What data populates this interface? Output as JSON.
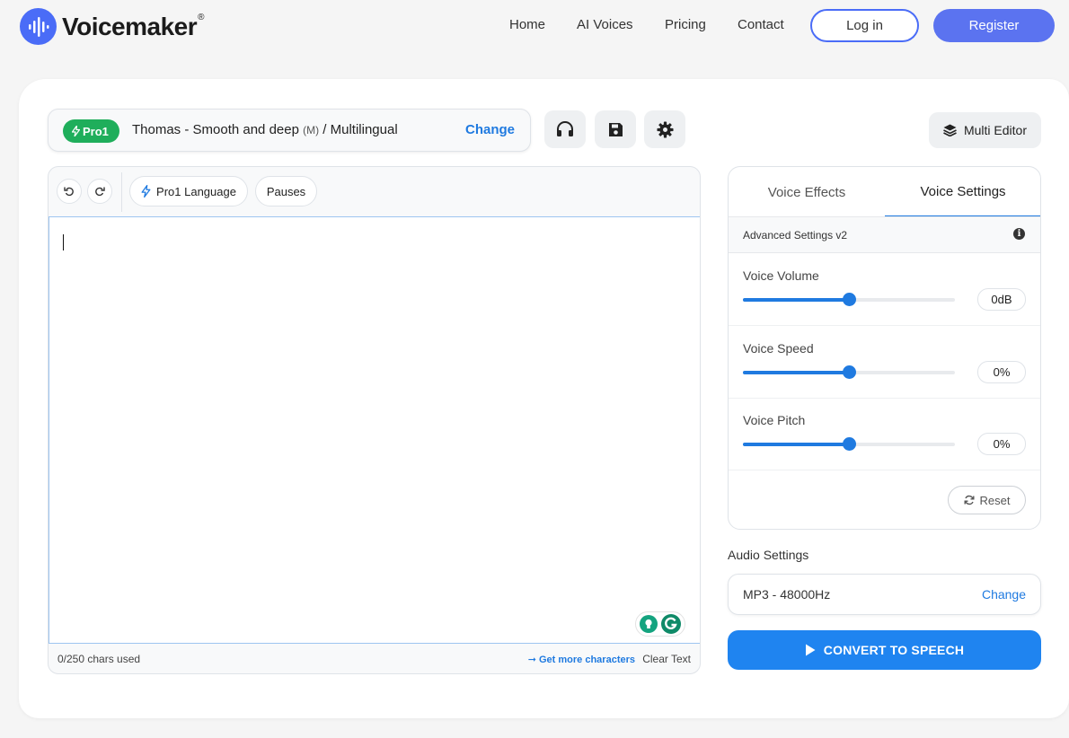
{
  "brand": {
    "name": "Voicemaker",
    "reg": "®"
  },
  "nav": {
    "items": [
      "Home",
      "AI Voices",
      "Pricing",
      "Contact"
    ],
    "login": "Log in",
    "register": "Register"
  },
  "voice": {
    "badge": "Pro1",
    "name": "Thomas - Smooth and deep",
    "gender": "(M)",
    "lang": "/ Multilingual",
    "change": "Change"
  },
  "toolbar": {
    "multi_editor": "Multi Editor",
    "pro_language": "Pro1 Language",
    "pauses": "Pauses"
  },
  "editor": {
    "chars_used": "0/250 chars used",
    "get_more": "Get more characters",
    "clear": "Clear Text"
  },
  "settings": {
    "tabs": [
      "Voice Effects",
      "Voice Settings"
    ],
    "active_tab": 1,
    "advanced_label": "Advanced Settings v2",
    "sliders": [
      {
        "label": "Voice Volume",
        "value": "0dB",
        "fraction": 0.5
      },
      {
        "label": "Voice Speed",
        "value": "0%",
        "fraction": 0.5
      },
      {
        "label": "Voice Pitch",
        "value": "0%",
        "fraction": 0.5
      }
    ],
    "reset": "Reset"
  },
  "audio": {
    "label": "Audio Settings",
    "format": "MP3 - 48000Hz",
    "change": "Change"
  },
  "convert": {
    "label": "CONVERT TO SPEECH"
  },
  "colors": {
    "accent": "#1f7ae0",
    "brand": "#4a6cf7",
    "badge": "#1fae5b"
  }
}
